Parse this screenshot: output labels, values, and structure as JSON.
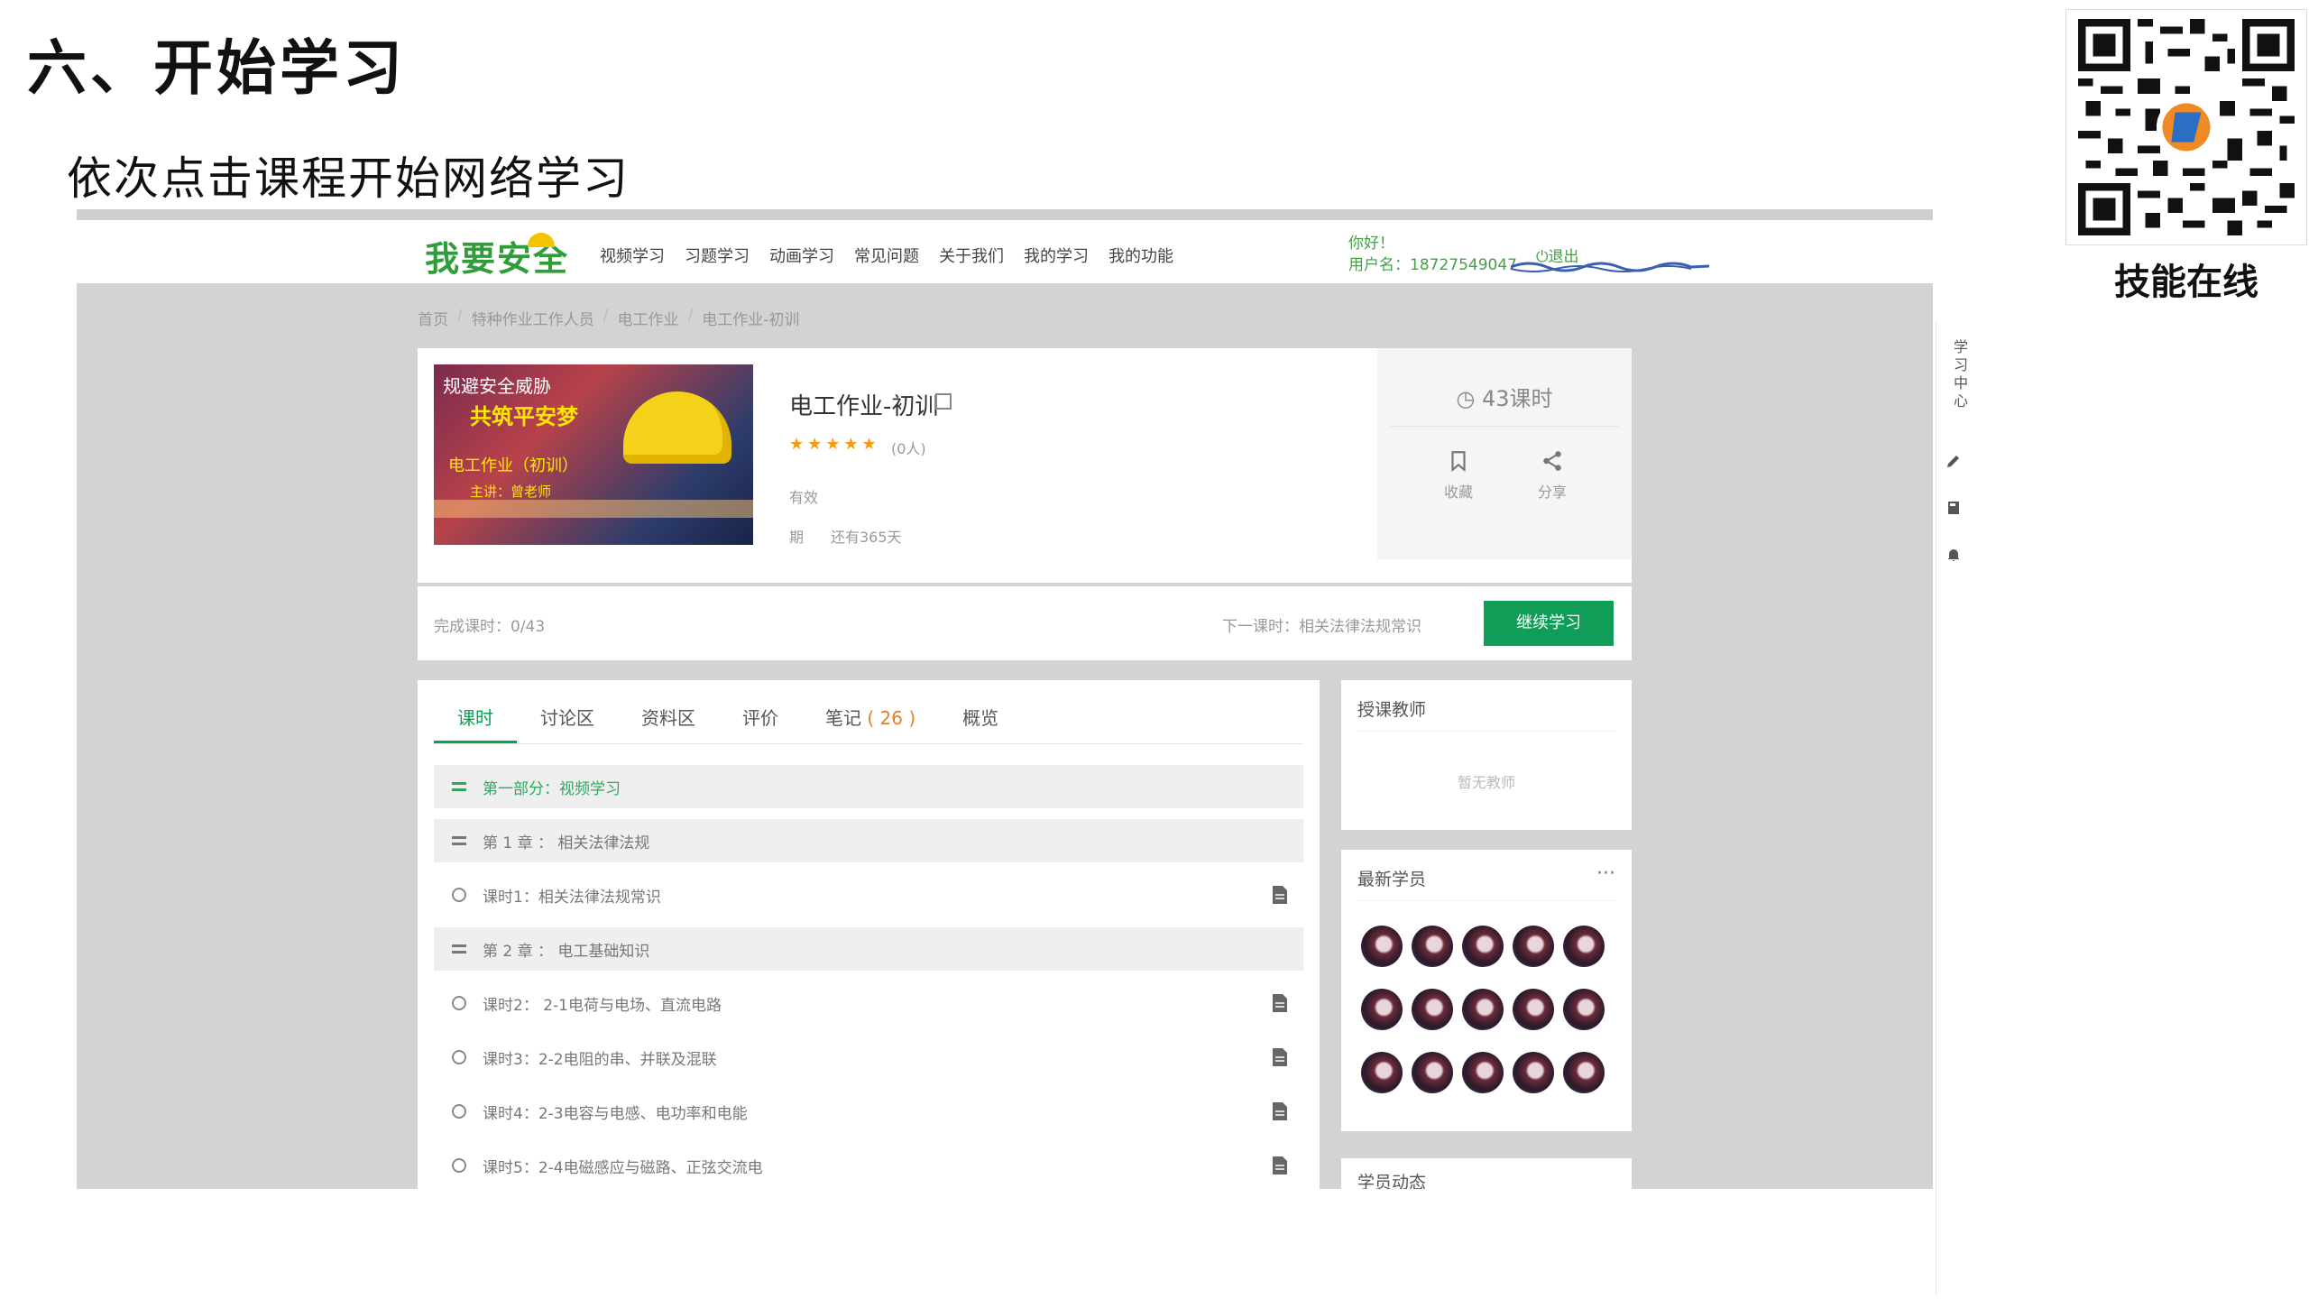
{
  "slide": {
    "title": "六、开始学习",
    "subtitle": "依次点击课程开始网络学习",
    "qr_caption": "技能在线"
  },
  "site": {
    "logo": "我要安全",
    "nav": [
      "视频学习",
      "习题学习",
      "动画学习",
      "常见问题",
      "关于我们",
      "我的学习",
      "我的功能"
    ],
    "greeting": "你好！",
    "username_label": "用户名：18727549047",
    "logout": "退出"
  },
  "breadcrumb": [
    "首页",
    "特种作业工作人员",
    "电工作业",
    "电工作业-初训"
  ],
  "course": {
    "image_text": [
      "规避安全威胁",
      "共筑平安梦",
      "电工作业（初训）",
      "主讲：曾老师"
    ],
    "name": "电工作业-初训",
    "stars": "★★★★★",
    "rating_count": "(0人)",
    "valid_label": "有效",
    "period_label": "期",
    "period_value": "还有365天",
    "hours": "43课时",
    "favorite": "收藏",
    "share": "分享"
  },
  "progress": {
    "done": "完成课时：0/43",
    "next": "下一课时：相关法律法规常识",
    "continue_button": "继续学习"
  },
  "tabs": [
    {
      "label": "课时",
      "active": true
    },
    {
      "label": "讨论区",
      "active": false
    },
    {
      "label": "资料区",
      "active": false
    },
    {
      "label": "评价",
      "active": false
    },
    {
      "label": "笔记",
      "count": "( 26 )",
      "active": false
    },
    {
      "label": "概览",
      "active": false
    }
  ],
  "lessons": [
    {
      "type": "section",
      "text": "第一部分：视频学习"
    },
    {
      "type": "section",
      "text": "第 1 章 ： 相关法律法规"
    },
    {
      "type": "lesson",
      "text": "课时1：相关法律法规常识"
    },
    {
      "type": "section",
      "text": "第 2 章 ： 电工基础知识"
    },
    {
      "type": "lesson",
      "text": "课时2： 2-1电荷与电场、直流电路"
    },
    {
      "type": "lesson",
      "text": "课时3：2-2电阻的串、并联及混联"
    },
    {
      "type": "lesson",
      "text": "课时4：2-3电容与电感、电功率和电能"
    },
    {
      "type": "lesson",
      "text": "课时5：2-4电磁感应与磁路、正弦交流电"
    }
  ],
  "teacher": {
    "title": "授课教师",
    "empty": "暂无教师"
  },
  "students": {
    "title": "最新学员",
    "more": "···",
    "count": 15
  },
  "activity": {
    "title": "学员动态"
  },
  "rail": {
    "label": "学习中心"
  },
  "colors": {
    "accent": "#0f9d58",
    "star": "#f39c12",
    "note_count": "#e67e22",
    "backdrop": "#d3d3d3"
  }
}
